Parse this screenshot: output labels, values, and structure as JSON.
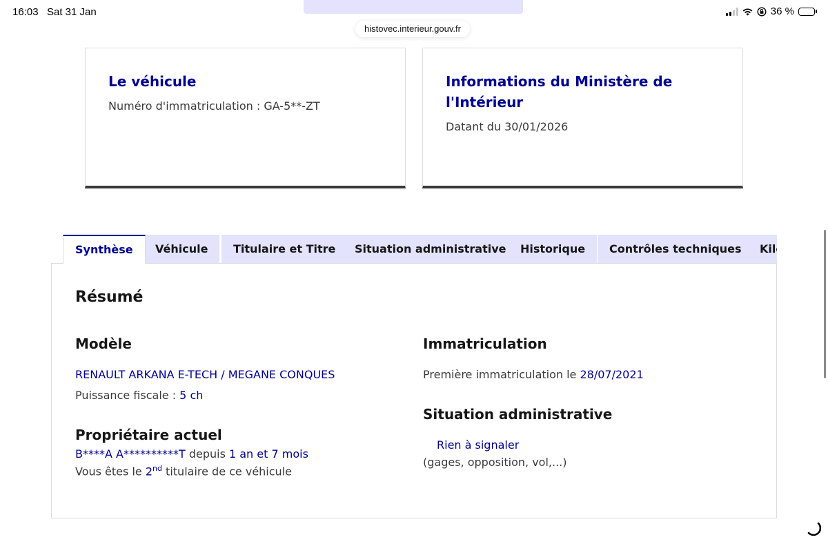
{
  "status_bar": {
    "time": "16:03",
    "date": "Sat 31 Jan",
    "battery": "36 %",
    "battery_level": 0.36,
    "icons": [
      "signal-icon",
      "wifi-icon",
      "orientation-lock-icon",
      "battery-icon"
    ]
  },
  "browser": {
    "url": "histovec.interieur.gouv.fr"
  },
  "cards": {
    "vehicle": {
      "title": "Le véhicule",
      "text": "Numéro d'immatriculation : GA-5**-ZT"
    },
    "ministry": {
      "title": "Informations du Ministère de l'Intérieur",
      "text": "Datant du 30/01/2026"
    }
  },
  "tabs": [
    {
      "label": "Synthèse",
      "active": true
    },
    {
      "label": "Véhicule"
    },
    {
      "label": "Titulaire et Titre"
    },
    {
      "label": "Situation administrative"
    },
    {
      "label": "Historique"
    },
    {
      "label": "Contrôles techniques"
    },
    {
      "label": "Kilométrage"
    }
  ],
  "summary": {
    "title": "Résumé",
    "model": {
      "title": "Modèle",
      "name": "RENAULT ARKANA E-TECH / MEGANE CONQUES",
      "power_label": "Puissance fiscale : ",
      "power_value": "5 ch"
    },
    "owner": {
      "title": "Propriétaire actuel",
      "name": "B****A A**********T",
      "since_label": " depuis ",
      "since_value": "1 an et 7 mois",
      "rank_prefix": "Vous êtes le ",
      "rank_number": "2",
      "rank_suffix": "nd",
      "rank_end": " titulaire de ce véhicule"
    },
    "registration": {
      "title": "Immatriculation",
      "label": "Première immatriculation le ",
      "date": "28/07/2021"
    },
    "admin": {
      "title": "Situation administrative",
      "status": "Rien à signaler",
      "note": "(gages, opposition, vol,...)"
    }
  },
  "colors": {
    "accent": "#000091",
    "tab_bg": "#e3e3fd",
    "text": "#161616",
    "muted": "#3a3a3a"
  }
}
